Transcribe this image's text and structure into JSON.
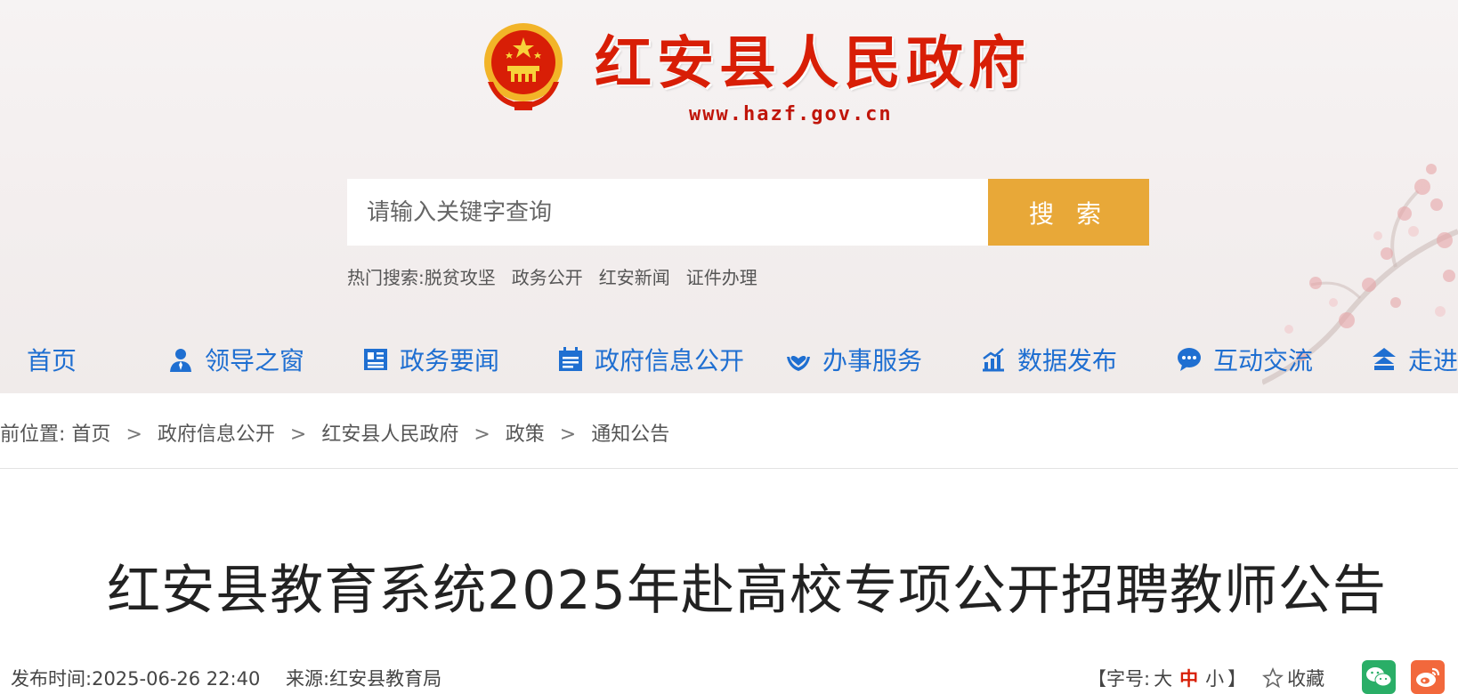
{
  "header": {
    "site_title": "红安县人民政府",
    "site_url": "www.hazf.gov.cn"
  },
  "search": {
    "placeholder": "请输入关键字查询",
    "button_label": "搜 索",
    "hot_label": "热门搜索:",
    "hot_terms": [
      "脱贫攻坚",
      "政务公开",
      "红安新闻",
      "证件办理"
    ]
  },
  "nav": {
    "items": [
      {
        "label": "首页",
        "icon": "home"
      },
      {
        "label": "领导之窗",
        "icon": "person-icon"
      },
      {
        "label": "政务要闻",
        "icon": "newspaper-icon"
      },
      {
        "label": "政府信息公开",
        "icon": "calendar-icon"
      },
      {
        "label": "办事服务",
        "icon": "hands-icon"
      },
      {
        "label": "数据发布",
        "icon": "chart-icon"
      },
      {
        "label": "互动交流",
        "icon": "chat-icon"
      },
      {
        "label": "走进",
        "icon": "building-icon"
      }
    ]
  },
  "breadcrumb": {
    "prefix": "前位置:",
    "items": [
      "首页",
      "政府信息公开",
      "红安县人民政府",
      "政策",
      "通知公告"
    ],
    "separator": ">"
  },
  "article": {
    "title": "红安县教育系统2025年赴高校专项公开招聘教师公告",
    "publish_label": "发布时间:",
    "publish_time": "2025-06-26 22:40",
    "source_label": "来源:",
    "source": "红安县教育局"
  },
  "tools": {
    "font_open": "【字号:",
    "font_large": "大",
    "font_medium": "中",
    "font_small": "小",
    "font_close": "】",
    "favorite": "收藏"
  },
  "colors": {
    "brand_red": "#d81e06",
    "nav_blue": "#1f6fd1",
    "search_button": "#e8a838",
    "wechat_green": "#2aae67",
    "weibo_orange": "#f2683c"
  }
}
